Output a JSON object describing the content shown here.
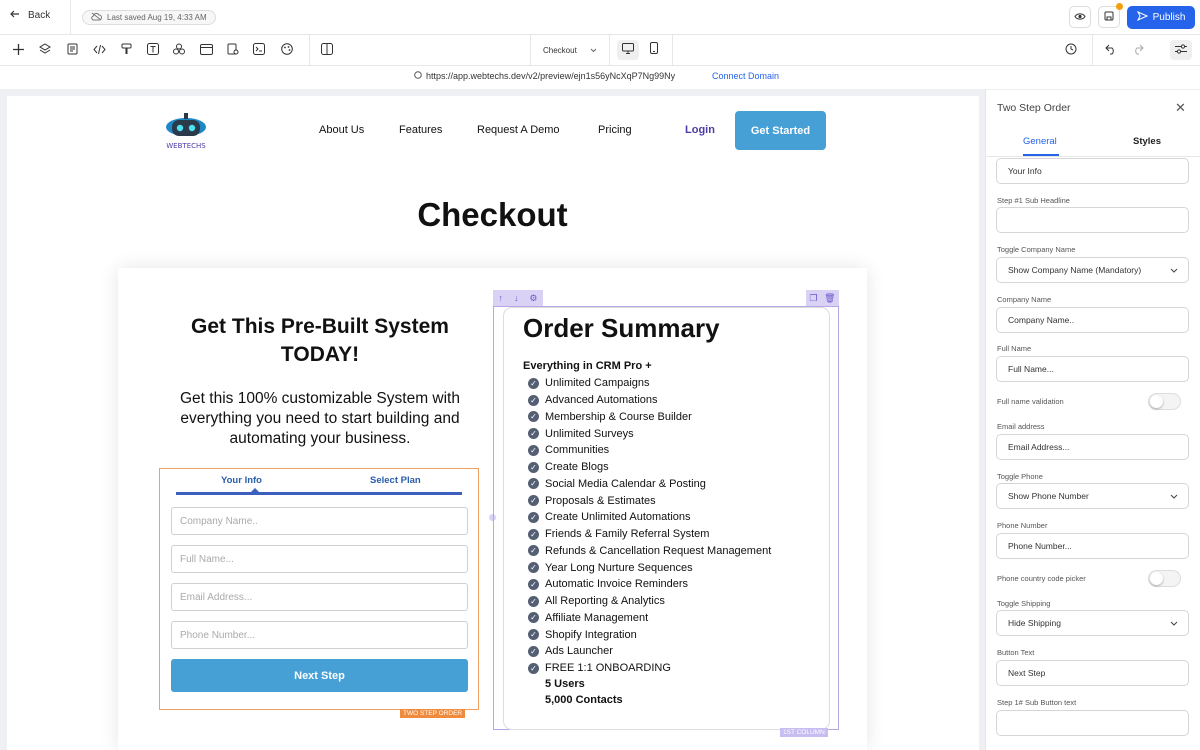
{
  "topbar": {
    "back_label": "Back",
    "saved_label": "Last saved Aug 19, 4:33 AM",
    "publish_label": "Publish"
  },
  "toolbar": {
    "page_select": "Checkout"
  },
  "urlbar": {
    "url": "https://app.webtechs.dev/v2/preview/ejn1s56yNcXqP7Ng99Ny",
    "connect_label": "Connect Domain"
  },
  "site": {
    "logo_text": "WEBTECHS",
    "nav": [
      "About Us",
      "Features",
      "Request A Demo",
      "Pricing"
    ],
    "login": "Login",
    "get_started": "Get Started",
    "page_title": "Checkout"
  },
  "left": {
    "headline": "Get This Pre-Built System TODAY!",
    "subheadline": "Get this 100% customizable System with everything you need to start building and automating your business.",
    "form": {
      "tab1": "Your Info",
      "tab2": "Select Plan",
      "company_placeholder": "Company Name..",
      "fullname_placeholder": "Full Name...",
      "email_placeholder": "Email Address...",
      "phone_placeholder": "Phone Number...",
      "next_button": "Next Step",
      "tag": "TWO STEP ORDER"
    }
  },
  "order": {
    "title": "Order Summary",
    "lead": "Everything in CRM Pro +",
    "features": [
      "Unlimited Campaigns",
      "Advanced Automations",
      "Membership & Course Builder",
      "Unlimited Surveys",
      "Communities",
      "Create Blogs",
      "Social Media Calendar & Posting",
      "Proposals & Estimates",
      "Create Unlimited Automations",
      "Friends & Family Referral System",
      "Refunds & Cancellation Request Management",
      "Year Long Nurture Sequences",
      "Automatic Invoice Reminders",
      "All Reporting & Analytics",
      "Affiliate Management",
      "Shopify Integration",
      "Ads Launcher",
      "FREE 1:1 ONBOARDING"
    ],
    "users": "5 Users",
    "contacts": "5,000 Contacts",
    "column_tag": "1ST COLUMN"
  },
  "panel": {
    "title": "Two Step Order",
    "tab_general": "General",
    "tab_styles": "Styles",
    "step1_headline_value": "Your Info",
    "step1_sub_headline_label": "Step #1 Sub Headline",
    "toggle_company_label": "Toggle Company Name",
    "toggle_company_value": "Show Company Name (Mandatory)",
    "company_label": "Company Name",
    "company_value": "Company Name..",
    "fullname_label": "Full Name",
    "fullname_value": "Full Name...",
    "fullname_validation_label": "Full name validation",
    "email_label": "Email address",
    "email_value": "Email Address...",
    "toggle_phone_label": "Toggle Phone",
    "toggle_phone_value": "Show Phone Number",
    "phone_label": "Phone Number",
    "phone_value": "Phone Number...",
    "phone_picker_label": "Phone country code picker",
    "toggle_shipping_label": "Toggle Shipping",
    "toggle_shipping_value": "Hide Shipping",
    "button_text_label": "Button Text",
    "button_text_value": "Next Step",
    "step1_sub_button_label": "Step 1# Sub Button text"
  },
  "colors": {
    "primary_blue": "#2563eb",
    "site_button": "#46a0d6",
    "form_border": "#f0a060",
    "selection": "#b5a7e6"
  }
}
